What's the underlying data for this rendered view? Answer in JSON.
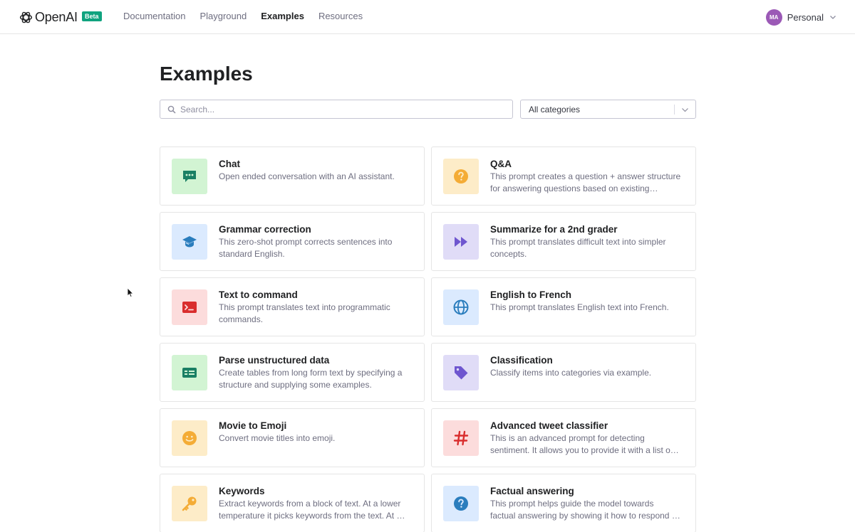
{
  "nav": {
    "brand": "OpenAI",
    "badge": "Beta",
    "links": [
      {
        "label": "Documentation",
        "active": false
      },
      {
        "label": "Playground",
        "active": false
      },
      {
        "label": "Examples",
        "active": true
      },
      {
        "label": "Resources",
        "active": false
      }
    ],
    "account": {
      "initials": "MA",
      "label": "Personal"
    }
  },
  "main": {
    "title": "Examples",
    "search": {
      "placeholder": "Search...",
      "value": ""
    },
    "category": {
      "selected": "All categories"
    }
  },
  "examples": [
    {
      "title": "Chat",
      "description": "Open ended conversation with an AI assistant.",
      "icon": "chat-icon",
      "bg": "#d2f4d3",
      "fg": "#1a7f64"
    },
    {
      "title": "Q&A",
      "description": "This prompt creates a question + answer structure for answering questions based on existing knowledge.",
      "icon": "question-icon",
      "bg": "#fdecc8",
      "fg": "#f4ac36"
    },
    {
      "title": "Grammar correction",
      "description": "This zero-shot prompt corrects sentences into standard English.",
      "icon": "graduation-cap-icon",
      "bg": "#dbeafe",
      "fg": "#2a7dbd"
    },
    {
      "title": "Summarize for a 2nd grader",
      "description": "This prompt translates difficult text into simpler concepts.",
      "icon": "fast-forward-icon",
      "bg": "#e0dcf7",
      "fg": "#6e56cf"
    },
    {
      "title": "Text to command",
      "description": "This prompt translates text into programmatic commands.",
      "icon": "terminal-icon",
      "bg": "#fcdcdc",
      "fg": "#d92d2d"
    },
    {
      "title": "English to French",
      "description": "This prompt translates English text into French.",
      "icon": "globe-icon",
      "bg": "#dbeafe",
      "fg": "#2a7dbd"
    },
    {
      "title": "Parse unstructured data",
      "description": "Create tables from long form text by specifying a structure and supplying some examples.",
      "icon": "table-icon",
      "bg": "#d2f4d3",
      "fg": "#1a7f64"
    },
    {
      "title": "Classification",
      "description": "Classify items into categories via example.",
      "icon": "tag-icon",
      "bg": "#e0dcf7",
      "fg": "#6e56cf"
    },
    {
      "title": "Movie to Emoji",
      "description": "Convert movie titles into emoji.",
      "icon": "smiley-icon",
      "bg": "#fdecc8",
      "fg": "#f4ac36"
    },
    {
      "title": "Advanced tweet classifier",
      "description": "This is an advanced prompt for detecting sentiment. It allows you to provide it with a list of status updates.",
      "icon": "hashtag-icon",
      "bg": "#fcdcdc",
      "fg": "#d92d2d"
    },
    {
      "title": "Keywords",
      "description": "Extract keywords from a block of text. At a lower temperature it picks keywords from the text. At a higher temperature it will generate related keywords.",
      "icon": "key-icon",
      "bg": "#fdecc8",
      "fg": "#f4ac36"
    },
    {
      "title": "Factual answering",
      "description": "This prompt helps guide the model towards factual answering by showing it how to respond to questions.",
      "icon": "question-icon",
      "bg": "#dbeafe",
      "fg": "#2a7dbd"
    }
  ]
}
